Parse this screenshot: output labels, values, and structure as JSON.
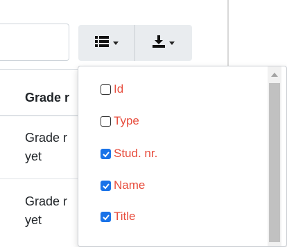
{
  "toolbar": {
    "columns_icon": "list-icon",
    "export_icon": "download-icon"
  },
  "table": {
    "header": "Grade r",
    "rows": [
      {
        "line1": "Grade r",
        "line2": "yet"
      },
      {
        "line1": "Grade r",
        "line2": "yet"
      }
    ]
  },
  "columns_menu": {
    "items": [
      {
        "label": "Id",
        "checked": false
      },
      {
        "label": "Type",
        "checked": false
      },
      {
        "label": "Stud. nr.",
        "checked": true
      },
      {
        "label": "Name",
        "checked": true
      },
      {
        "label": "Title",
        "checked": true
      }
    ]
  },
  "colors": {
    "item_text": "#e74c3c",
    "checkbox_checked": "#1a73e8",
    "button_bg": "#e9ecef"
  }
}
